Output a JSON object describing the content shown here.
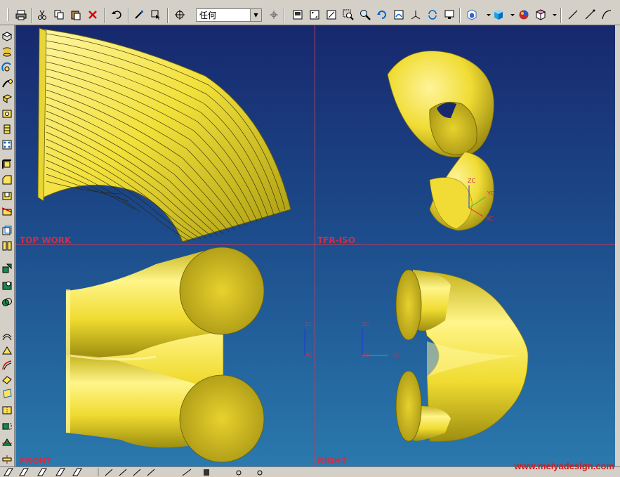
{
  "toolbar": {
    "filter_value": "任何"
  },
  "viewports": {
    "top_left": "TOP WORK",
    "top_right": "TFR-ISO",
    "bottom_left": "FRONT",
    "bottom_right": "RIGHT"
  },
  "axes": {
    "zc": "ZC",
    "yc": "YC",
    "xc": "XC"
  },
  "watermark": "www.meiyadesign.com",
  "colors": {
    "viewport_top": "#17286d",
    "viewport_bottom": "#2a79ad",
    "surface": "#f0df3a",
    "divider": "#b8405c",
    "label": "#c8324a"
  }
}
